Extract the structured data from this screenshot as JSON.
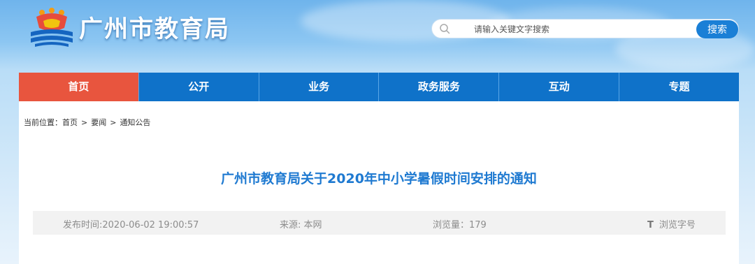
{
  "header": {
    "site_title": "广州市教育局",
    "search": {
      "placeholder": "请输入关键文字搜索",
      "button_label": "搜索"
    }
  },
  "nav": {
    "items": [
      {
        "label": "首页",
        "active": true
      },
      {
        "label": "公开"
      },
      {
        "label": "业务"
      },
      {
        "label": "政务服务"
      },
      {
        "label": "互动"
      },
      {
        "label": "专题"
      }
    ]
  },
  "breadcrumb": {
    "prefix": "当前位置：",
    "items": [
      "首页",
      "要闻",
      "通知公告"
    ],
    "separator": ">"
  },
  "article": {
    "title": "广州市教育局关于2020年中小学暑假时间安排的通知",
    "publish_time": "发布时间:2020-06-02 19:00:57",
    "source": "来源: 本网",
    "views": "浏览量：179",
    "font_size_label": "浏览字号",
    "font_size_icon_text": "T"
  },
  "colors": {
    "nav_bg": "#0f72c9",
    "nav_active": "#e8553e",
    "title": "#1f7ad1",
    "search_button": "#1a7fd6"
  }
}
